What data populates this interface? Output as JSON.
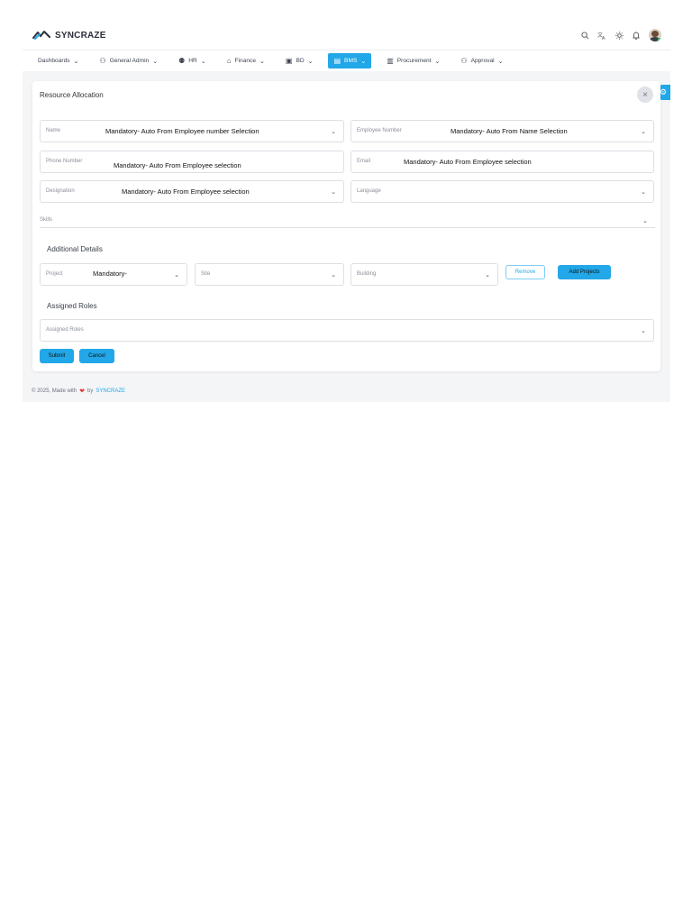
{
  "app": {
    "brand": "SYNCRAZE",
    "accent": "#22a7e8"
  },
  "topbar": {
    "icons": [
      "search-icon",
      "translate-icon",
      "sun-icon",
      "bell-icon",
      "avatar"
    ]
  },
  "nav": [
    {
      "label": "Dashboards",
      "icon": ""
    },
    {
      "label": "General Admin",
      "icon": "user-cog-icon"
    },
    {
      "label": "HR",
      "icon": "people-icon"
    },
    {
      "label": "Finance",
      "icon": "bank-icon"
    },
    {
      "label": "BD",
      "icon": "briefcase-icon"
    },
    {
      "label": "BMS",
      "icon": "building-icon",
      "active": true
    },
    {
      "label": "Procurement",
      "icon": "clipboard-icon"
    },
    {
      "label": "Approval",
      "icon": "user-check-icon"
    }
  ],
  "form": {
    "title": "Resource Allocation",
    "fields": {
      "name": {
        "label": "Name",
        "value": "Mandatory- Auto From Employee  number Selection"
      },
      "employee_number": {
        "label": "Employee Number",
        "value": "Mandatory- Auto From Name Selection"
      },
      "phone": {
        "label": "Phone Number",
        "value": "Mandatory- Auto From Employee selection"
      },
      "email": {
        "label": "Email",
        "value": "Mandatory- Auto From Employee selection"
      },
      "designation": {
        "label": "Designation",
        "value": "Mandatory- Auto From Employee selection"
      },
      "language": {
        "label": "Language",
        "value": ""
      },
      "skills": {
        "label": "Skills"
      }
    },
    "additional": {
      "title": "Additional Details",
      "project": {
        "label": "Project",
        "value": "Mandatory-"
      },
      "site": {
        "label": "Site"
      },
      "building": {
        "label": "Building"
      },
      "remove_label": "Remove",
      "add_label": "Add Projects"
    },
    "roles": {
      "title": "Assigned Roles",
      "placeholder": "Assigned Roles"
    },
    "submit_label": "Submit",
    "cancel_label": "Cancel"
  },
  "footer": {
    "copyright": "© 2025, Made with",
    "by": "by",
    "brand": "SYNCRAZE"
  }
}
